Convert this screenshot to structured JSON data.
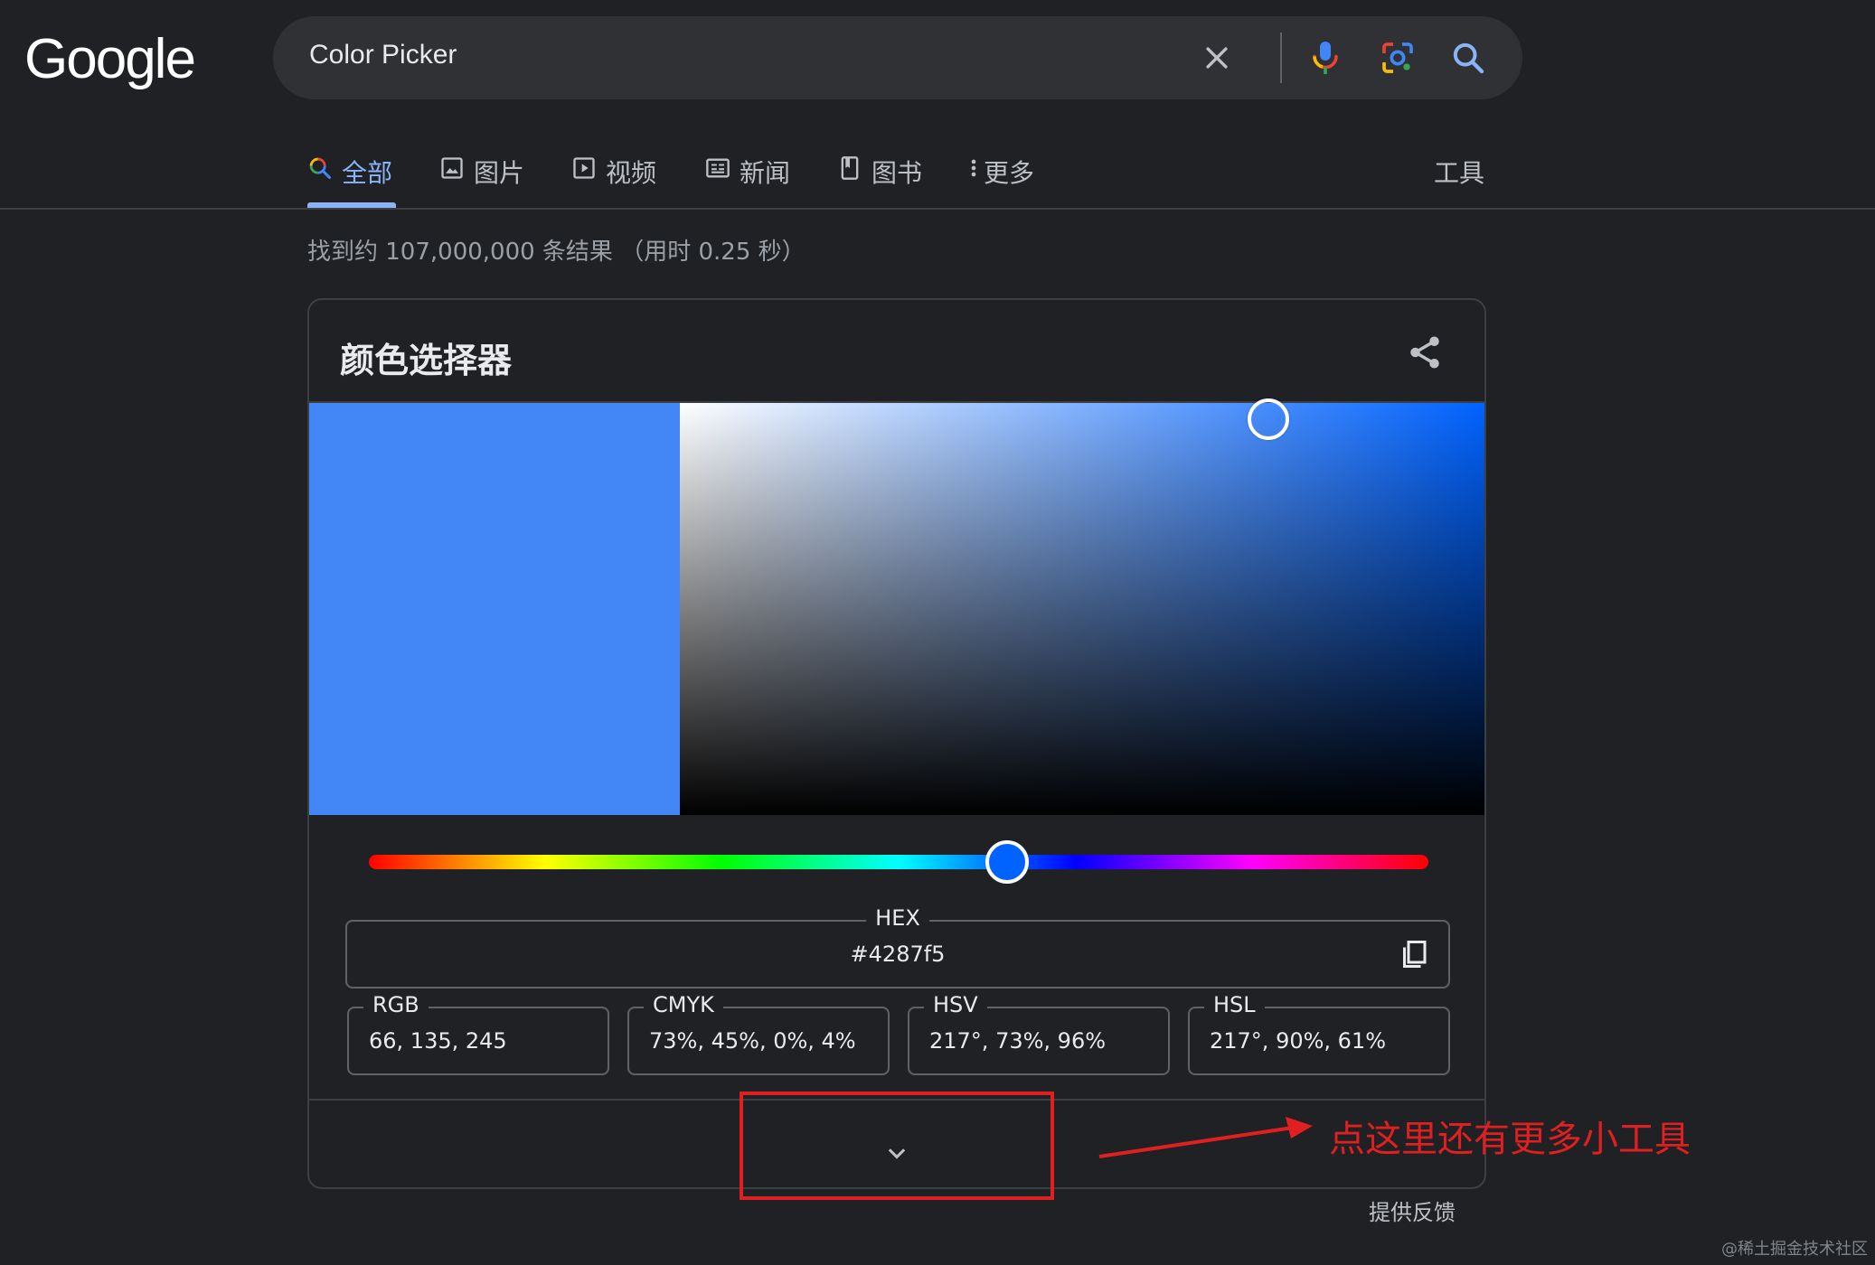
{
  "header": {
    "logo": "Google",
    "search_value": "Color Picker"
  },
  "tabs": [
    {
      "label": "全部",
      "icon": "search-icon",
      "active": true
    },
    {
      "label": "图片",
      "icon": "image-icon"
    },
    {
      "label": "视频",
      "icon": "play-icon"
    },
    {
      "label": "新闻",
      "icon": "news-icon"
    },
    {
      "label": "图书",
      "icon": "book-icon"
    },
    {
      "label": "更多",
      "icon": "more-vert-icon"
    }
  ],
  "tools_label": "工具",
  "result_stats": "找到约 107,000,000 条结果 （用时 0.25 秒）",
  "picker": {
    "title": "颜色选择器",
    "selected_color": "#4287f5",
    "saturation": 0.73,
    "value": 0.96,
    "hue_degrees": 217,
    "hex_label": "HEX",
    "hex_value": "#4287f5",
    "rgb_label": "RGB",
    "rgb_value": "66, 135, 245",
    "cmyk_label": "CMYK",
    "cmyk_value": "73%, 45%, 0%, 4%",
    "hsv_label": "HSV",
    "hsv_value": "217°, 73%, 96%",
    "hsl_label": "HSL",
    "hsl_value": "217°, 90%, 61%"
  },
  "annotation": {
    "text": "点这里还有更多小工具",
    "color": "#e02020"
  },
  "feedback_label": "提供反馈",
  "watermark": "@稀土掘金技术社区",
  "colors": {
    "background": "#202124",
    "accent": "#8ab4f8",
    "hue_color": "#0062ff"
  }
}
